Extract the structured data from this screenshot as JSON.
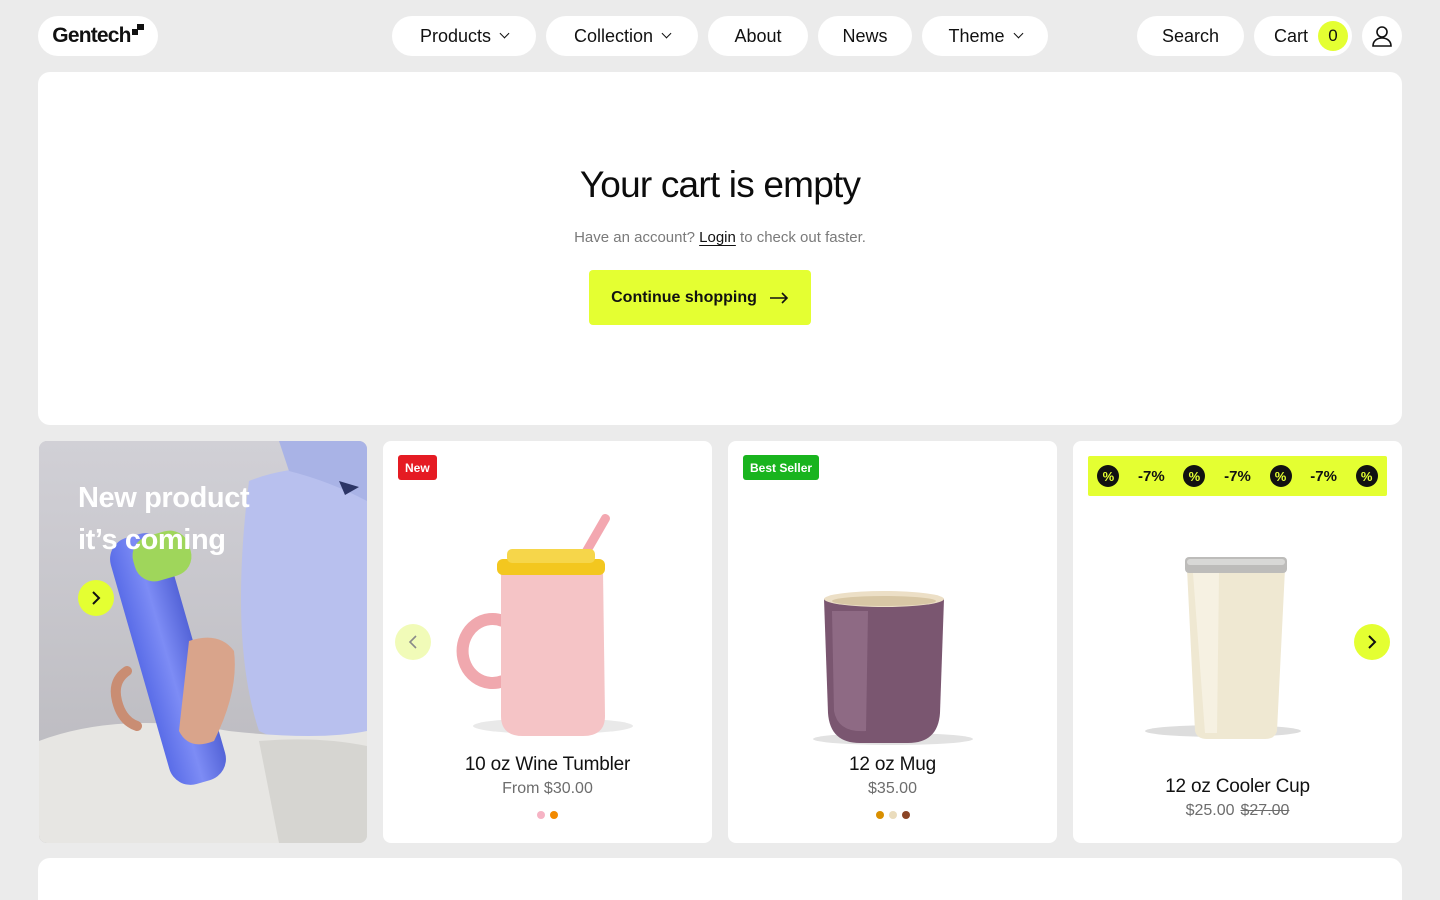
{
  "header": {
    "logo": "Gentech",
    "nav": [
      {
        "label": "Products"
      },
      {
        "label": "Collection"
      },
      {
        "label": "About"
      },
      {
        "label": "News"
      },
      {
        "label": "Theme"
      }
    ],
    "search_label": "Search",
    "cart_label": "Cart",
    "cart_count": "0"
  },
  "cart": {
    "title": "Your cart is empty",
    "login_prefix": "Have an account?",
    "login_link": "Login",
    "login_suffix": "to check out faster.",
    "cta_label": "Continue shopping"
  },
  "promo": {
    "line1": "New product",
    "line2": "it’s coming"
  },
  "products": [
    {
      "badge": "New",
      "name": "10 oz Wine Tumbler",
      "price": "From $30.00",
      "swatches": [
        "#f6b3c4",
        "#f28a00"
      ]
    },
    {
      "badge": "Best Seller",
      "name": "12 oz Mug",
      "price": "$35.00",
      "swatches": [
        "#d98f00",
        "#eadcbd",
        "#8b4526"
      ]
    },
    {
      "badge": "-7%",
      "name": "12 oz Cooler Cup",
      "price": "$25.00",
      "compare_price": "$27.00"
    }
  ],
  "colors": {
    "accent": "#e4ff32",
    "new_badge": "#e51b23",
    "best_badge": "#19b41e"
  }
}
